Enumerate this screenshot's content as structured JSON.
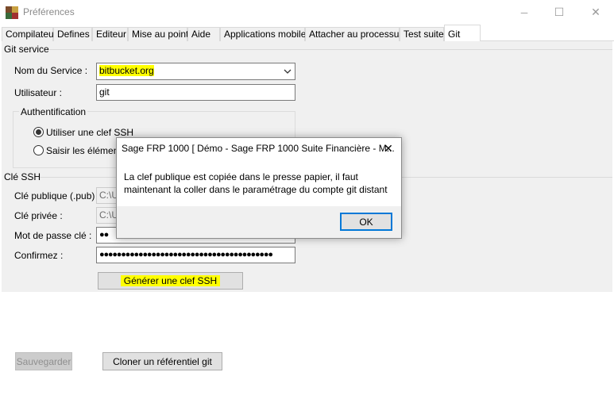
{
  "window": {
    "title": "Préférences",
    "minimize_glyph": "─",
    "maximize_glyph": "☐",
    "close_glyph": "✕"
  },
  "tabs": [
    {
      "label": "Compilateur"
    },
    {
      "label": "Defines"
    },
    {
      "label": "Editeur"
    },
    {
      "label": "Mise au point"
    },
    {
      "label": "Aide"
    },
    {
      "label": "Applications mobiles"
    },
    {
      "label": "Attacher au processus"
    },
    {
      "label": "Test suite"
    },
    {
      "label": "Git"
    }
  ],
  "git_service": {
    "section_label": "Git service",
    "service_label": "Nom du Service :",
    "service_value": "bitbucket.org",
    "user_label": "Utilisateur :",
    "user_value": "git",
    "auth_group_label": "Authentification",
    "auth_options": [
      {
        "label": "Utiliser une clef SSH",
        "selected": true
      },
      {
        "label": "Saisir les éléments",
        "selected": false
      }
    ]
  },
  "ssh": {
    "section_label": "Clé SSH",
    "public_key_label": "Clé publique (.pub) :",
    "public_key_value": "C:\\U",
    "private_key_label": "Clé privée :",
    "private_key_value": "C:\\U",
    "password_label": "Mot de passe clé :",
    "password_value": "●●",
    "confirm_label": "Confirmez :",
    "confirm_value": "●●●●●●●●●●●●●●●●●●●●●●●●●●●●●●●●●●●●●●●●",
    "generate_button": "Générer une clef SSH"
  },
  "footer": {
    "save_button": "Sauvegarder",
    "clone_button": "Cloner un référentiel git"
  },
  "dialog": {
    "title": "Sage FRP 1000 [ Démo - Sage FRP 1000 Suite Financière - M...",
    "close_glyph": "✕",
    "message_line1": "La clef publique est copiée dans le presse papier, il faut",
    "message_line2": "maintenant la coller dans le paramétrage du compte git distant",
    "ok_button": "OK"
  },
  "colors": {
    "highlight": "#ffff00",
    "dialog_focus_border": "#0078d7"
  }
}
